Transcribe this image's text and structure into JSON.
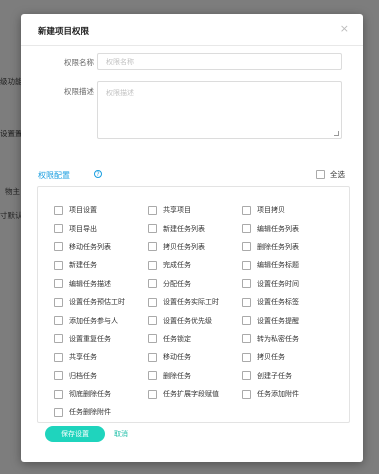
{
  "background": {
    "fragments": [
      "级功能",
      "设置置",
      "物主",
      "寸默认"
    ]
  },
  "dialog": {
    "title": "新建项目权限",
    "close_glyph": "×",
    "name_label": "权限名称",
    "name_placeholder": "权限名称",
    "desc_label": "权限描述",
    "desc_placeholder": "权限描述",
    "section_title": "权限配置",
    "help_glyph": "?",
    "select_all_label": "全选",
    "permissions": [
      "项目设置",
      "共享项目",
      "项目拷贝",
      "项目导出",
      "新建任务列表",
      "编辑任务列表",
      "移动任务列表",
      "拷贝任务列表",
      "删除任务列表",
      "新建任务",
      "完成任务",
      "编辑任务标题",
      "编辑任务描述",
      "分配任务",
      "设置任务时间",
      "设置任务预估工时",
      "设置任务实际工时",
      "设置任务标签",
      "添加任务参与人",
      "设置任务优先级",
      "设置任务提醒",
      "设置重复任务",
      "任务锁定",
      "转为私密任务",
      "共享任务",
      "移动任务",
      "拷贝任务",
      "归档任务",
      "删除任务",
      "创建子任务",
      "彻底删除任务",
      "任务扩展字段赋值",
      "任务添加附件",
      "任务删除附件"
    ],
    "save_label": "保存设置",
    "cancel_label": "取消"
  },
  "colors": {
    "accent": "#1fd4bd",
    "link": "#1a9ee0",
    "overlay": "#7d7d7d"
  }
}
